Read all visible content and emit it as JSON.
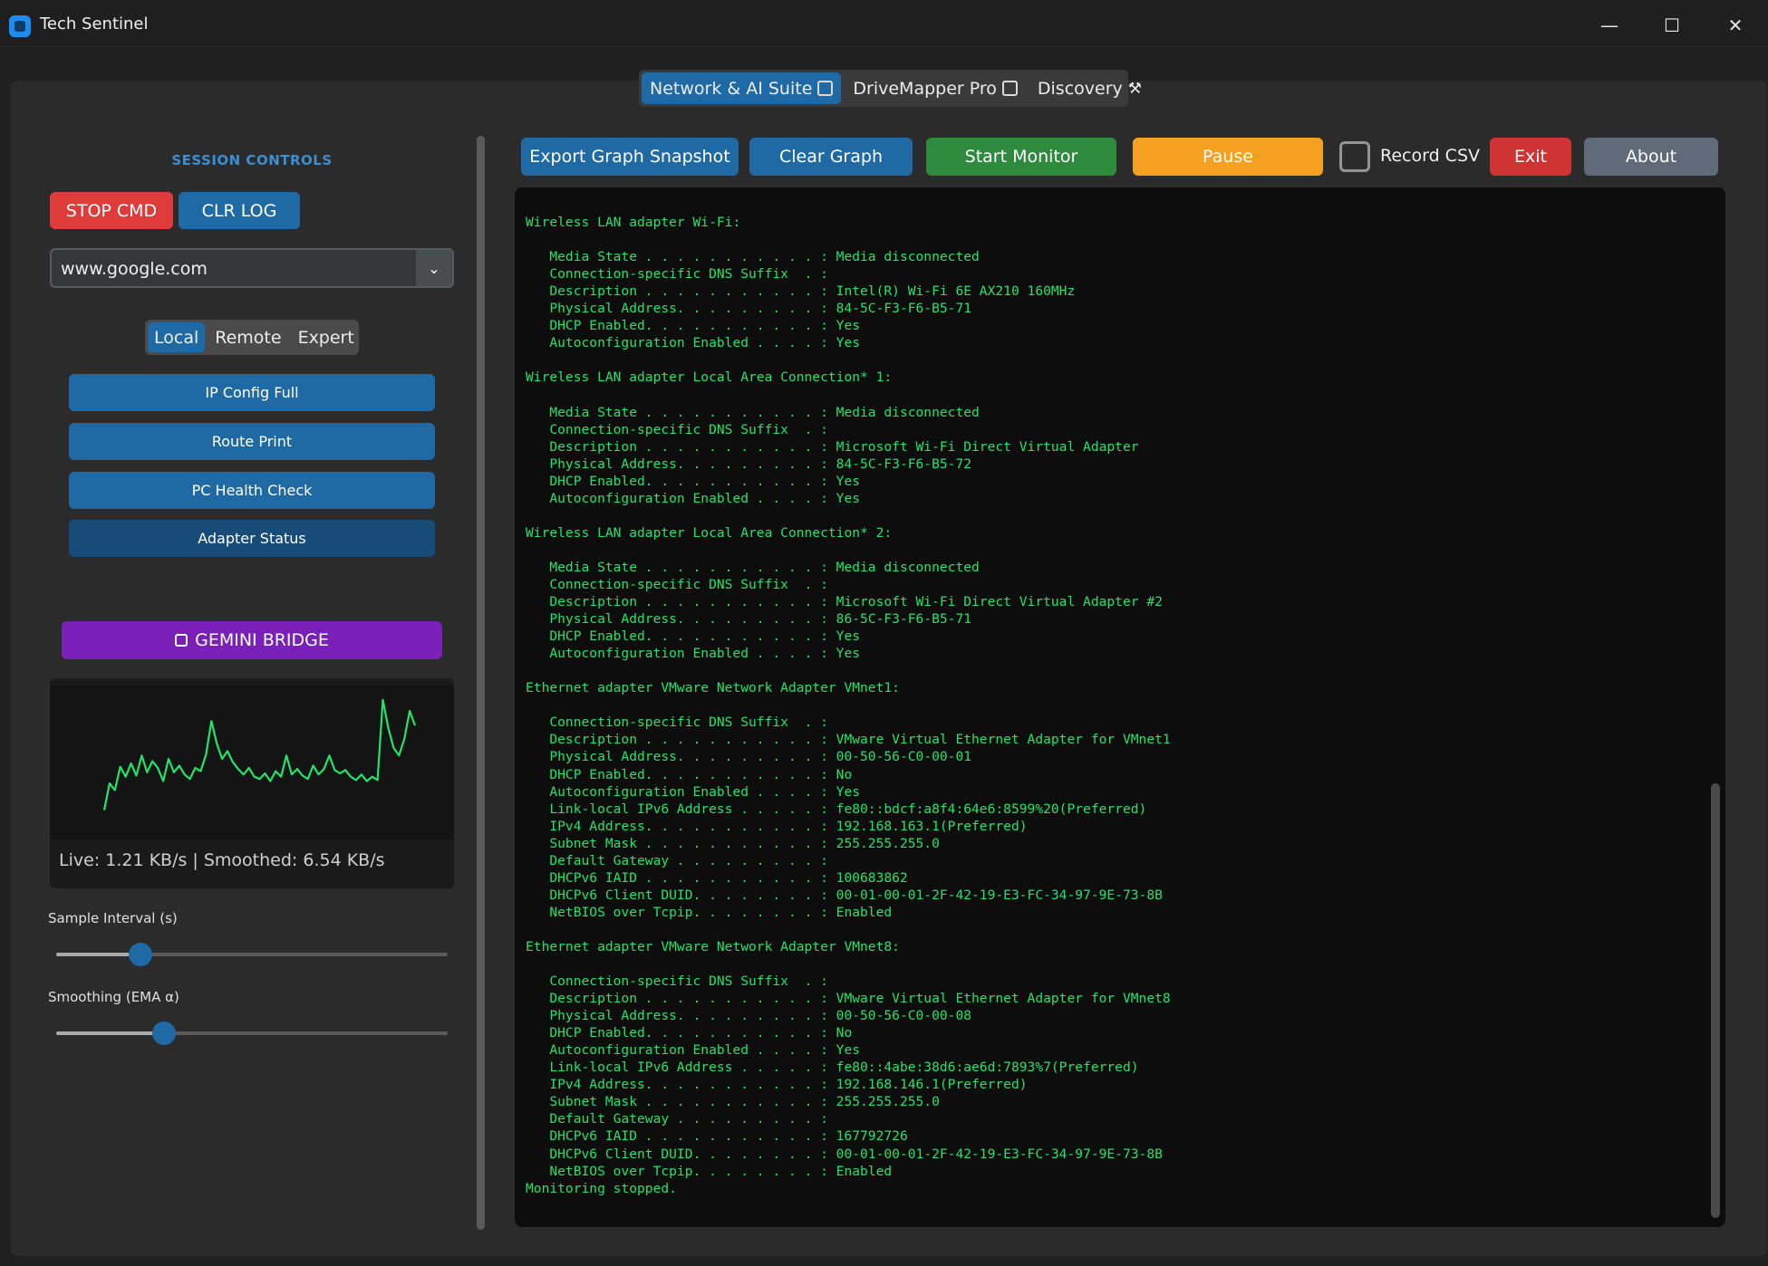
{
  "window": {
    "title": "Tech Sentinel",
    "minimize": "—",
    "maximize": "☐",
    "close": "✕"
  },
  "top_tabs": [
    {
      "label": "Network & AI Suite",
      "icon": "wifi-router-icon"
    },
    {
      "label": "DriveMapper Pro",
      "icon": "floppy-disk-icon"
    },
    {
      "label": "Discovery",
      "icon": "magic-wand-icon"
    }
  ],
  "left_panel": {
    "session_title": "SESSION CONTROLS",
    "stop_cmd": "STOP CMD",
    "clr_log": "CLR LOG",
    "target": {
      "value": "www.google.com",
      "arrow": "⌄"
    },
    "mode_tabs": [
      "Local",
      "Remote",
      "Expert"
    ],
    "commands": [
      "IP Config Full",
      "Route Print",
      "PC Health Check",
      "Adapter Status"
    ],
    "gemini_bridge": "GEMINI BRIDGE",
    "graph_status": "Live: 1.21 KB/s | Smoothed: 6.54 KB/s",
    "sample_interval": {
      "label": "Sample Interval (s)",
      "fraction": 0.215
    },
    "smoothing": {
      "label": "Smoothing (EMA α)",
      "fraction": 0.275
    }
  },
  "throughput_series": [
    0.6,
    3.0,
    2.4,
    4.5,
    3.6,
    4.8,
    3.7,
    5.5,
    4.0,
    5.0,
    4.4,
    3.2,
    5.2,
    4.0,
    4.6,
    3.8,
    3.4,
    4.4,
    4.1,
    5.6,
    8.6,
    6.6,
    5.2,
    5.9,
    4.9,
    4.3,
    3.8,
    4.4,
    3.6,
    3.4,
    3.9,
    3.2,
    4.1,
    3.6,
    5.5,
    3.8,
    4.3,
    3.7,
    3.4,
    4.6,
    3.8,
    4.3,
    5.5,
    4.2,
    3.9,
    4.2,
    3.6,
    3.3,
    3.8,
    3.2,
    3.6,
    3.3,
    10.5,
    8.0,
    6.2,
    5.5,
    7.0,
    9.5,
    8.2
  ],
  "toolbar": {
    "export": "Export Graph Snapshot",
    "clear": "Clear Graph",
    "start": "Start Monitor",
    "pause": "Pause",
    "record_csv": "Record CSV",
    "exit": "Exit",
    "about": "About"
  },
  "colors": {
    "accent": "#1f6aa5",
    "stop": "#e03b3b",
    "start": "#2e8b3e",
    "pause": "#f5a020",
    "exit": "#d03333",
    "about": "#5f6b78",
    "gemini": "#7a1fb8",
    "console_text": "#22e36b"
  },
  "console_lines": [
    "Wireless LAN adapter Wi-Fi:",
    "",
    "   Media State . . . . . . . . . . . : Media disconnected",
    "   Connection-specific DNS Suffix  . :",
    "   Description . . . . . . . . . . . : Intel(R) Wi-Fi 6E AX210 160MHz",
    "   Physical Address. . . . . . . . . : 84-5C-F3-F6-B5-71",
    "   DHCP Enabled. . . . . . . . . . . : Yes",
    "   Autoconfiguration Enabled . . . . : Yes",
    "",
    "Wireless LAN adapter Local Area Connection* 1:",
    "",
    "   Media State . . . . . . . . . . . : Media disconnected",
    "   Connection-specific DNS Suffix  . :",
    "   Description . . . . . . . . . . . : Microsoft Wi-Fi Direct Virtual Adapter",
    "   Physical Address. . . . . . . . . : 84-5C-F3-F6-B5-72",
    "   DHCP Enabled. . . . . . . . . . . : Yes",
    "   Autoconfiguration Enabled . . . . : Yes",
    "",
    "Wireless LAN adapter Local Area Connection* 2:",
    "",
    "   Media State . . . . . . . . . . . : Media disconnected",
    "   Connection-specific DNS Suffix  . :",
    "   Description . . . . . . . . . . . : Microsoft Wi-Fi Direct Virtual Adapter #2",
    "   Physical Address. . . . . . . . . : 86-5C-F3-F6-B5-71",
    "   DHCP Enabled. . . . . . . . . . . : Yes",
    "   Autoconfiguration Enabled . . . . : Yes",
    "",
    "Ethernet adapter VMware Network Adapter VMnet1:",
    "",
    "   Connection-specific DNS Suffix  . :",
    "   Description . . . . . . . . . . . : VMware Virtual Ethernet Adapter for VMnet1",
    "   Physical Address. . . . . . . . . : 00-50-56-C0-00-01",
    "   DHCP Enabled. . . . . . . . . . . : No",
    "   Autoconfiguration Enabled . . . . : Yes",
    "   Link-local IPv6 Address . . . . . : fe80::bdcf:a8f4:64e6:8599%20(Preferred)",
    "   IPv4 Address. . . . . . . . . . . : 192.168.163.1(Preferred)",
    "   Subnet Mask . . . . . . . . . . . : 255.255.255.0",
    "   Default Gateway . . . . . . . . . :",
    "   DHCPv6 IAID . . . . . . . . . . . : 100683862",
    "   DHCPv6 Client DUID. . . . . . . . : 00-01-00-01-2F-42-19-E3-FC-34-97-9E-73-8B",
    "   NetBIOS over Tcpip. . . . . . . . : Enabled",
    "",
    "Ethernet adapter VMware Network Adapter VMnet8:",
    "",
    "   Connection-specific DNS Suffix  . :",
    "   Description . . . . . . . . . . . : VMware Virtual Ethernet Adapter for VMnet8",
    "   Physical Address. . . . . . . . . : 00-50-56-C0-00-08",
    "   DHCP Enabled. . . . . . . . . . . : No",
    "   Autoconfiguration Enabled . . . . : Yes",
    "   Link-local IPv6 Address . . . . . : fe80::4abe:38d6:ae6d:7893%7(Preferred)",
    "   IPv4 Address. . . . . . . . . . . : 192.168.146.1(Preferred)",
    "   Subnet Mask . . . . . . . . . . . : 255.255.255.0",
    "   Default Gateway . . . . . . . . . :",
    "   DHCPv6 IAID . . . . . . . . . . . : 167792726",
    "   DHCPv6 Client DUID. . . . . . . . : 00-01-00-01-2F-42-19-E3-FC-34-97-9E-73-8B",
    "   NetBIOS over Tcpip. . . . . . . . : Enabled",
    "Monitoring stopped."
  ]
}
